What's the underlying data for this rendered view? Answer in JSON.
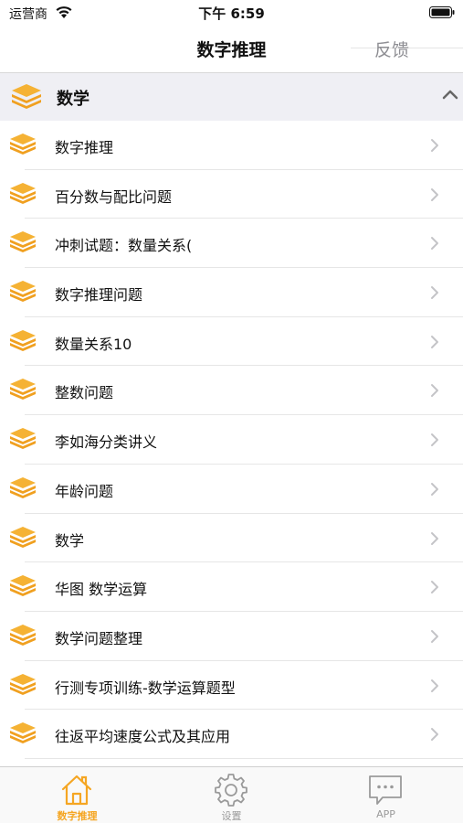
{
  "status_bar": {
    "carrier": "运营商",
    "time": "下午 6:59"
  },
  "nav": {
    "title": "数字推理",
    "feedback": "反馈"
  },
  "section": {
    "title": "数学",
    "icon": "layers-icon",
    "expanded_icon": "chevron-up-icon"
  },
  "items": [
    {
      "label": "数字推理"
    },
    {
      "label": "百分数与配比问题"
    },
    {
      "label": "冲刺试题：数量关系("
    },
    {
      "label": "数字推理问题"
    },
    {
      "label": "数量关系10"
    },
    {
      "label": "整数问题"
    },
    {
      "label": "李如海分类讲义"
    },
    {
      "label": "年龄问题"
    },
    {
      "label": "数学"
    },
    {
      "label": "华图  数学运算"
    },
    {
      "label": "数学问题整理"
    },
    {
      "label": "行测专项训练-数学运算题型"
    },
    {
      "label": "往返平均速度公式及其应用"
    }
  ],
  "tabs": [
    {
      "label": "数字推理",
      "icon": "home-icon",
      "active": true
    },
    {
      "label": "设置",
      "icon": "gear-icon",
      "active": false
    },
    {
      "label": "APP",
      "icon": "chat-bubble-icon",
      "active": false
    }
  ],
  "colors": {
    "accent": "#f5a623",
    "icon_orange": "#f0a020",
    "header_bg": "#efeff4"
  }
}
